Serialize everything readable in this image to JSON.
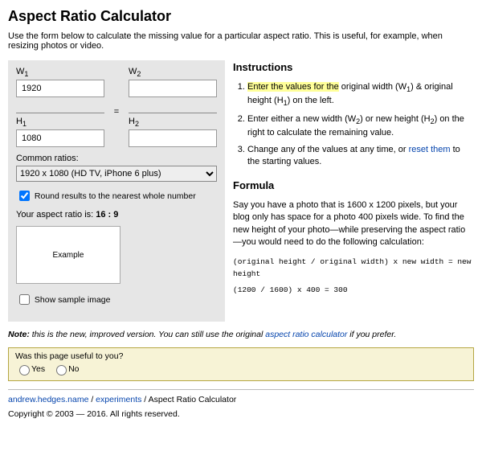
{
  "title": "Aspect Ratio Calculator",
  "intro": "Use the form below to calculate the missing value for a particular aspect ratio. This is useful, for example, when resizing photos or video.",
  "calc": {
    "w1_label_pre": "W",
    "w1_label_sub": "1",
    "w1_value": "1920",
    "w2_label_pre": "W",
    "w2_label_sub": "2",
    "w2_value": "",
    "h1_label_pre": "H",
    "h1_label_sub": "1",
    "h1_value": "1080",
    "h2_label_pre": "H",
    "h2_label_sub": "2",
    "h2_value": "",
    "equals": "=",
    "common_label": "Common ratios:",
    "common_selected": "1920 x 1080 (HD TV, iPhone 6 plus)",
    "round_label": "Round results to the nearest whole number",
    "round_checked": true,
    "ratio_prefix": "Your aspect ratio is: ",
    "ratio_value": "16 : 9",
    "example_label": "Example",
    "show_sample_label": "Show sample image",
    "show_sample_checked": false
  },
  "instructions": {
    "heading": "Instructions",
    "step1_pre": "Enter the values for the",
    "step1_rest": " original width (W",
    "step1_sub1": "1",
    "step1_mid": ") & original height (H",
    "step1_sub2": "1",
    "step1_end": ") on the left.",
    "step2_a": "Enter either a new width (W",
    "step2_sub1": "2",
    "step2_b": ") or new height (H",
    "step2_sub2": "2",
    "step2_c": ") on the right to calculate the remaining value.",
    "step3_a": "Change any of the values at any time, or ",
    "step3_link": "reset them",
    "step3_b": " to the starting values."
  },
  "formula": {
    "heading": "Formula",
    "paragraph": "Say you have a photo that is 1600 x 1200 pixels, but your blog only has space for a photo 400 pixels wide. To find the new height of your photo—while preserving the aspect ratio—you would need to do the following calculation:",
    "code1": "(original height / original width) x new width = new height",
    "code2": "(1200 / 1600) x 400 = 300"
  },
  "note": {
    "bold": "Note:",
    "text_a": " this is the new, improved version. You can still use the original ",
    "link": "aspect ratio calculator",
    "text_b": " if you prefer."
  },
  "feedback": {
    "question": "Was this page useful to you?",
    "yes": "Yes",
    "no": "No"
  },
  "breadcrumb": {
    "b1": "andrew.hedges.name",
    "sep": " / ",
    "b2": "experiments",
    "current": "Aspect Ratio Calculator"
  },
  "copyright": "Copyright © 2003 — 2016. All rights reserved."
}
